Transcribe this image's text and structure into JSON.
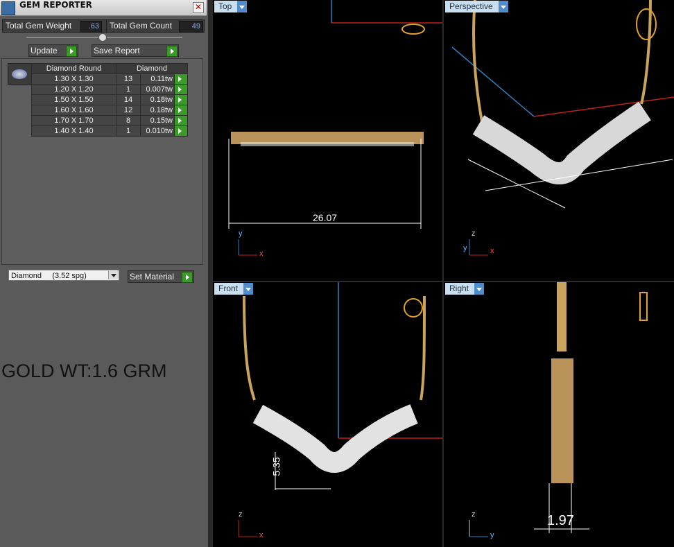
{
  "panel": {
    "title": "GEM REPORTER",
    "total_gem_weight_label": "Total Gem Weight",
    "total_gem_weight_value": ".63",
    "total_gem_count_label": "Total Gem Count",
    "total_gem_count_value": "49",
    "update_label": "Update",
    "save_report_label": "Save Report",
    "table": {
      "headers": [
        "Diamond Round",
        "Diamond"
      ],
      "rows": [
        {
          "size": "1.30 X 1.30",
          "count": "13",
          "weight": "0.11tw"
        },
        {
          "size": "1.20 X 1.20",
          "count": "1",
          "weight": "0.007tw"
        },
        {
          "size": "1.50 X 1.50",
          "count": "14",
          "weight": "0.18tw"
        },
        {
          "size": "1.60 X 1.60",
          "count": "12",
          "weight": "0.18tw"
        },
        {
          "size": "1.70 X 1.70",
          "count": "8",
          "weight": "0.15tw"
        },
        {
          "size": "1.40 X 1.40",
          "count": "1",
          "weight": "0.010tw"
        }
      ]
    },
    "material_select": "Diamond     (3.52 spg)",
    "set_material_label": "Set Material",
    "gold_weight_note": "GOLD WT:1.6 GRM"
  },
  "viewports": {
    "top": {
      "label": "Top",
      "dimension": "26.07"
    },
    "perspective": {
      "label": "Perspective"
    },
    "front": {
      "label": "Front",
      "dimension": "5.35"
    },
    "right": {
      "label": "Right",
      "dimension": "1.97"
    }
  },
  "axes": {
    "x": "x",
    "y": "y",
    "z": "z"
  },
  "colors": {
    "accent": "#4f8cc9",
    "gold": "#c9a45c",
    "viewport_border": "#5fa7d6",
    "axis_red": "#c0201c",
    "axis_blue": "#2f7fbf"
  }
}
